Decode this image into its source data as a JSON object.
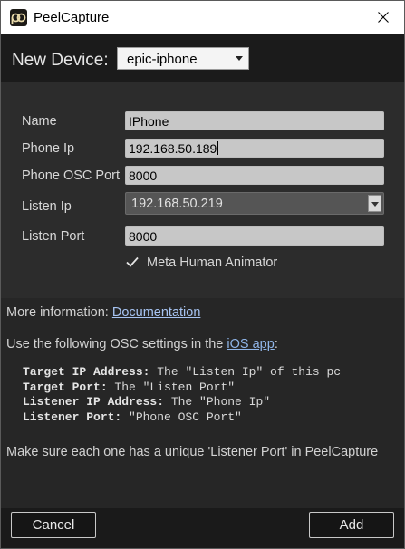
{
  "window": {
    "title": "PeelCapture",
    "icon": "peelcapture-logo-icon",
    "close_icon": "close-icon"
  },
  "header": {
    "new_device_label": "New Device:",
    "device_type_value": "epic-iphone"
  },
  "form": {
    "name_label": "Name",
    "name_value": "IPhone",
    "phone_ip_label": "Phone Ip",
    "phone_ip_value": "192.168.50.189",
    "phone_osc_port_label": "Phone OSC Port",
    "phone_osc_port_value": "8000",
    "listen_ip_label": "Listen Ip",
    "listen_ip_value": "192.168.50.219",
    "listen_port_label": "Listen Port",
    "listen_port_value": "8000",
    "meta_human_label": "Meta Human Animator",
    "meta_human_checked": true
  },
  "info": {
    "more_info_prefix": "More information: ",
    "documentation_link": "Documentation",
    "osc_intro_prefix": "Use the following OSC settings in the ",
    "ios_app_link": "iOS app",
    "osc_intro_suffix": ":",
    "settings": [
      {
        "key": "Target IP Address:",
        "value": " The \"Listen Ip\" of this pc"
      },
      {
        "key": "Target Port:",
        "value": " The \"Listen Port\""
      },
      {
        "key": "Listener IP Address:",
        "value": " The \"Phone Ip\""
      },
      {
        "key": "Listener Port:",
        "value": " \"Phone OSC Port\""
      }
    ],
    "unique_note": "Make sure each one has a unique 'Listener Port' in PeelCapture"
  },
  "footer": {
    "cancel_label": "Cancel",
    "add_label": "Add"
  },
  "colors": {
    "link": "#8fb5e8",
    "background": "#262626",
    "panel": "#2c2c2c"
  }
}
